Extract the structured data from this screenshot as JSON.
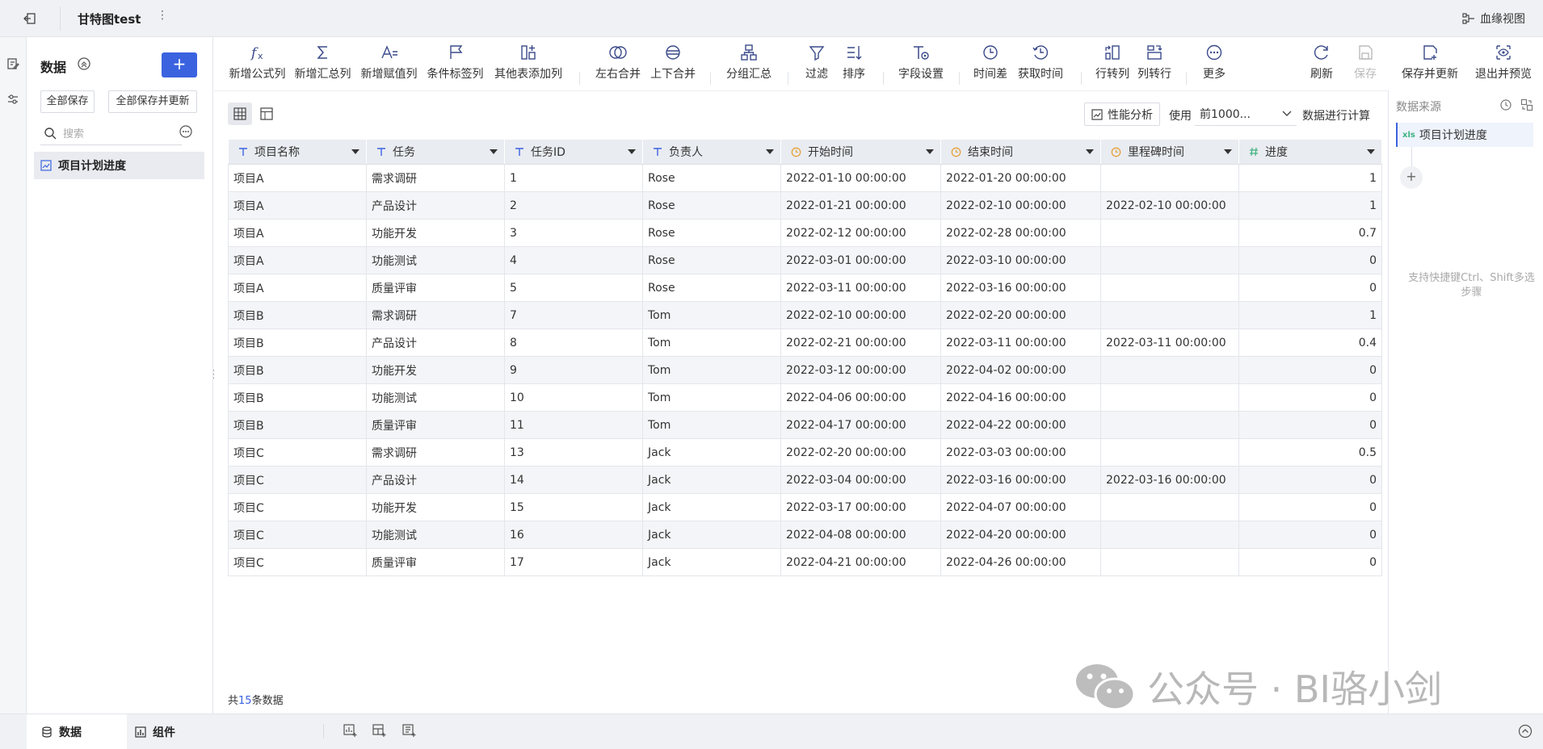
{
  "header": {
    "title": "甘特图test",
    "more": "⋮",
    "lineage": "血缘视图"
  },
  "left_panel": {
    "title": "数据",
    "add": "+",
    "save_all": "全部保存",
    "save_all_update": "全部保存并更新",
    "search_placeholder": "搜索",
    "items": [
      "项目计划进度"
    ]
  },
  "toolbar": {
    "formula_col": "新增公式列",
    "summary_col": "新增汇总列",
    "assign_col": "新增赋值列",
    "condition_col": "条件标签列",
    "other_table_col": "其他表添加列",
    "lr_merge": "左右合并",
    "ud_merge": "上下合并",
    "group_summary": "分组汇总",
    "filter": "过滤",
    "sort": "排序",
    "field_settings": "字段设置",
    "time_diff": "时间差",
    "get_time": "获取时间",
    "row_to_col": "行转列",
    "col_to_row": "列转行",
    "more": "更多",
    "refresh": "刷新",
    "save": "保存",
    "save_update": "保存并更新",
    "exit_preview": "退出并预览"
  },
  "main": {
    "perf_analysis": "性能分析",
    "use_label": "使用",
    "use_select": "前1000...",
    "calc_label": "数据进行计算",
    "footer_prefix": "共",
    "footer_count": "15",
    "footer_suffix": "条数据"
  },
  "table": {
    "columns": [
      {
        "name": "项目名称",
        "type": "text"
      },
      {
        "name": "任务",
        "type": "text"
      },
      {
        "name": "任务ID",
        "type": "text"
      },
      {
        "name": "负责人",
        "type": "text"
      },
      {
        "name": "开始时间",
        "type": "time"
      },
      {
        "name": "结束时间",
        "type": "time"
      },
      {
        "name": "里程碑时间",
        "type": "time"
      },
      {
        "name": "进度",
        "type": "number"
      }
    ],
    "rows": [
      [
        "项目A",
        "需求调研",
        "1",
        "Rose",
        "2022-01-10 00:00:00",
        "2022-01-20 00:00:00",
        "",
        "1"
      ],
      [
        "项目A",
        "产品设计",
        "2",
        "Rose",
        "2022-01-21 00:00:00",
        "2022-02-10 00:00:00",
        "2022-02-10 00:00:00",
        "1"
      ],
      [
        "项目A",
        "功能开发",
        "3",
        "Rose",
        "2022-02-12 00:00:00",
        "2022-02-28 00:00:00",
        "",
        "0.7"
      ],
      [
        "项目A",
        "功能测试",
        "4",
        "Rose",
        "2022-03-01 00:00:00",
        "2022-03-10 00:00:00",
        "",
        "0"
      ],
      [
        "项目A",
        "质量评审",
        "5",
        "Rose",
        "2022-03-11 00:00:00",
        "2022-03-16 00:00:00",
        "",
        "0"
      ],
      [
        "项目B",
        "需求调研",
        "7",
        "Tom",
        "2022-02-10 00:00:00",
        "2022-02-20 00:00:00",
        "",
        "1"
      ],
      [
        "项目B",
        "产品设计",
        "8",
        "Tom",
        "2022-02-21 00:00:00",
        "2022-03-11 00:00:00",
        "2022-03-11 00:00:00",
        "0.4"
      ],
      [
        "项目B",
        "功能开发",
        "9",
        "Tom",
        "2022-03-12 00:00:00",
        "2022-04-02 00:00:00",
        "",
        "0"
      ],
      [
        "项目B",
        "功能测试",
        "10",
        "Tom",
        "2022-04-06 00:00:00",
        "2022-04-16 00:00:00",
        "",
        "0"
      ],
      [
        "项目B",
        "质量评审",
        "11",
        "Tom",
        "2022-04-17 00:00:00",
        "2022-04-22 00:00:00",
        "",
        "0"
      ],
      [
        "项目C",
        "需求调研",
        "13",
        "Jack",
        "2022-02-20 00:00:00",
        "2022-03-03 00:00:00",
        "",
        "0.5"
      ],
      [
        "项目C",
        "产品设计",
        "14",
        "Jack",
        "2022-03-04 00:00:00",
        "2022-03-16 00:00:00",
        "2022-03-16 00:00:00",
        "0"
      ],
      [
        "项目C",
        "功能开发",
        "15",
        "Jack",
        "2022-03-17 00:00:00",
        "2022-04-07 00:00:00",
        "",
        "0"
      ],
      [
        "项目C",
        "功能测试",
        "16",
        "Jack",
        "2022-04-08 00:00:00",
        "2022-04-20 00:00:00",
        "",
        "0"
      ],
      [
        "项目C",
        "质量评审",
        "17",
        "Jack",
        "2022-04-21 00:00:00",
        "2022-04-26 00:00:00",
        "",
        "0"
      ]
    ]
  },
  "right_panel": {
    "title": "数据来源",
    "source_badge": "xls",
    "source": "项目计划进度",
    "add": "+",
    "hint": "支持快捷键Ctrl、Shift多选步骤"
  },
  "bottom": {
    "tab_data": "数据",
    "tab_component": "组件"
  },
  "watermark": {
    "text": "公众号 · BI骆小剑"
  },
  "colors": {
    "accent": "#3b63e0",
    "header_bg": "#e9ecf1",
    "time_icon": "#e8a13a",
    "number_icon": "#3fb27f",
    "text_icon": "#3b63e0"
  }
}
